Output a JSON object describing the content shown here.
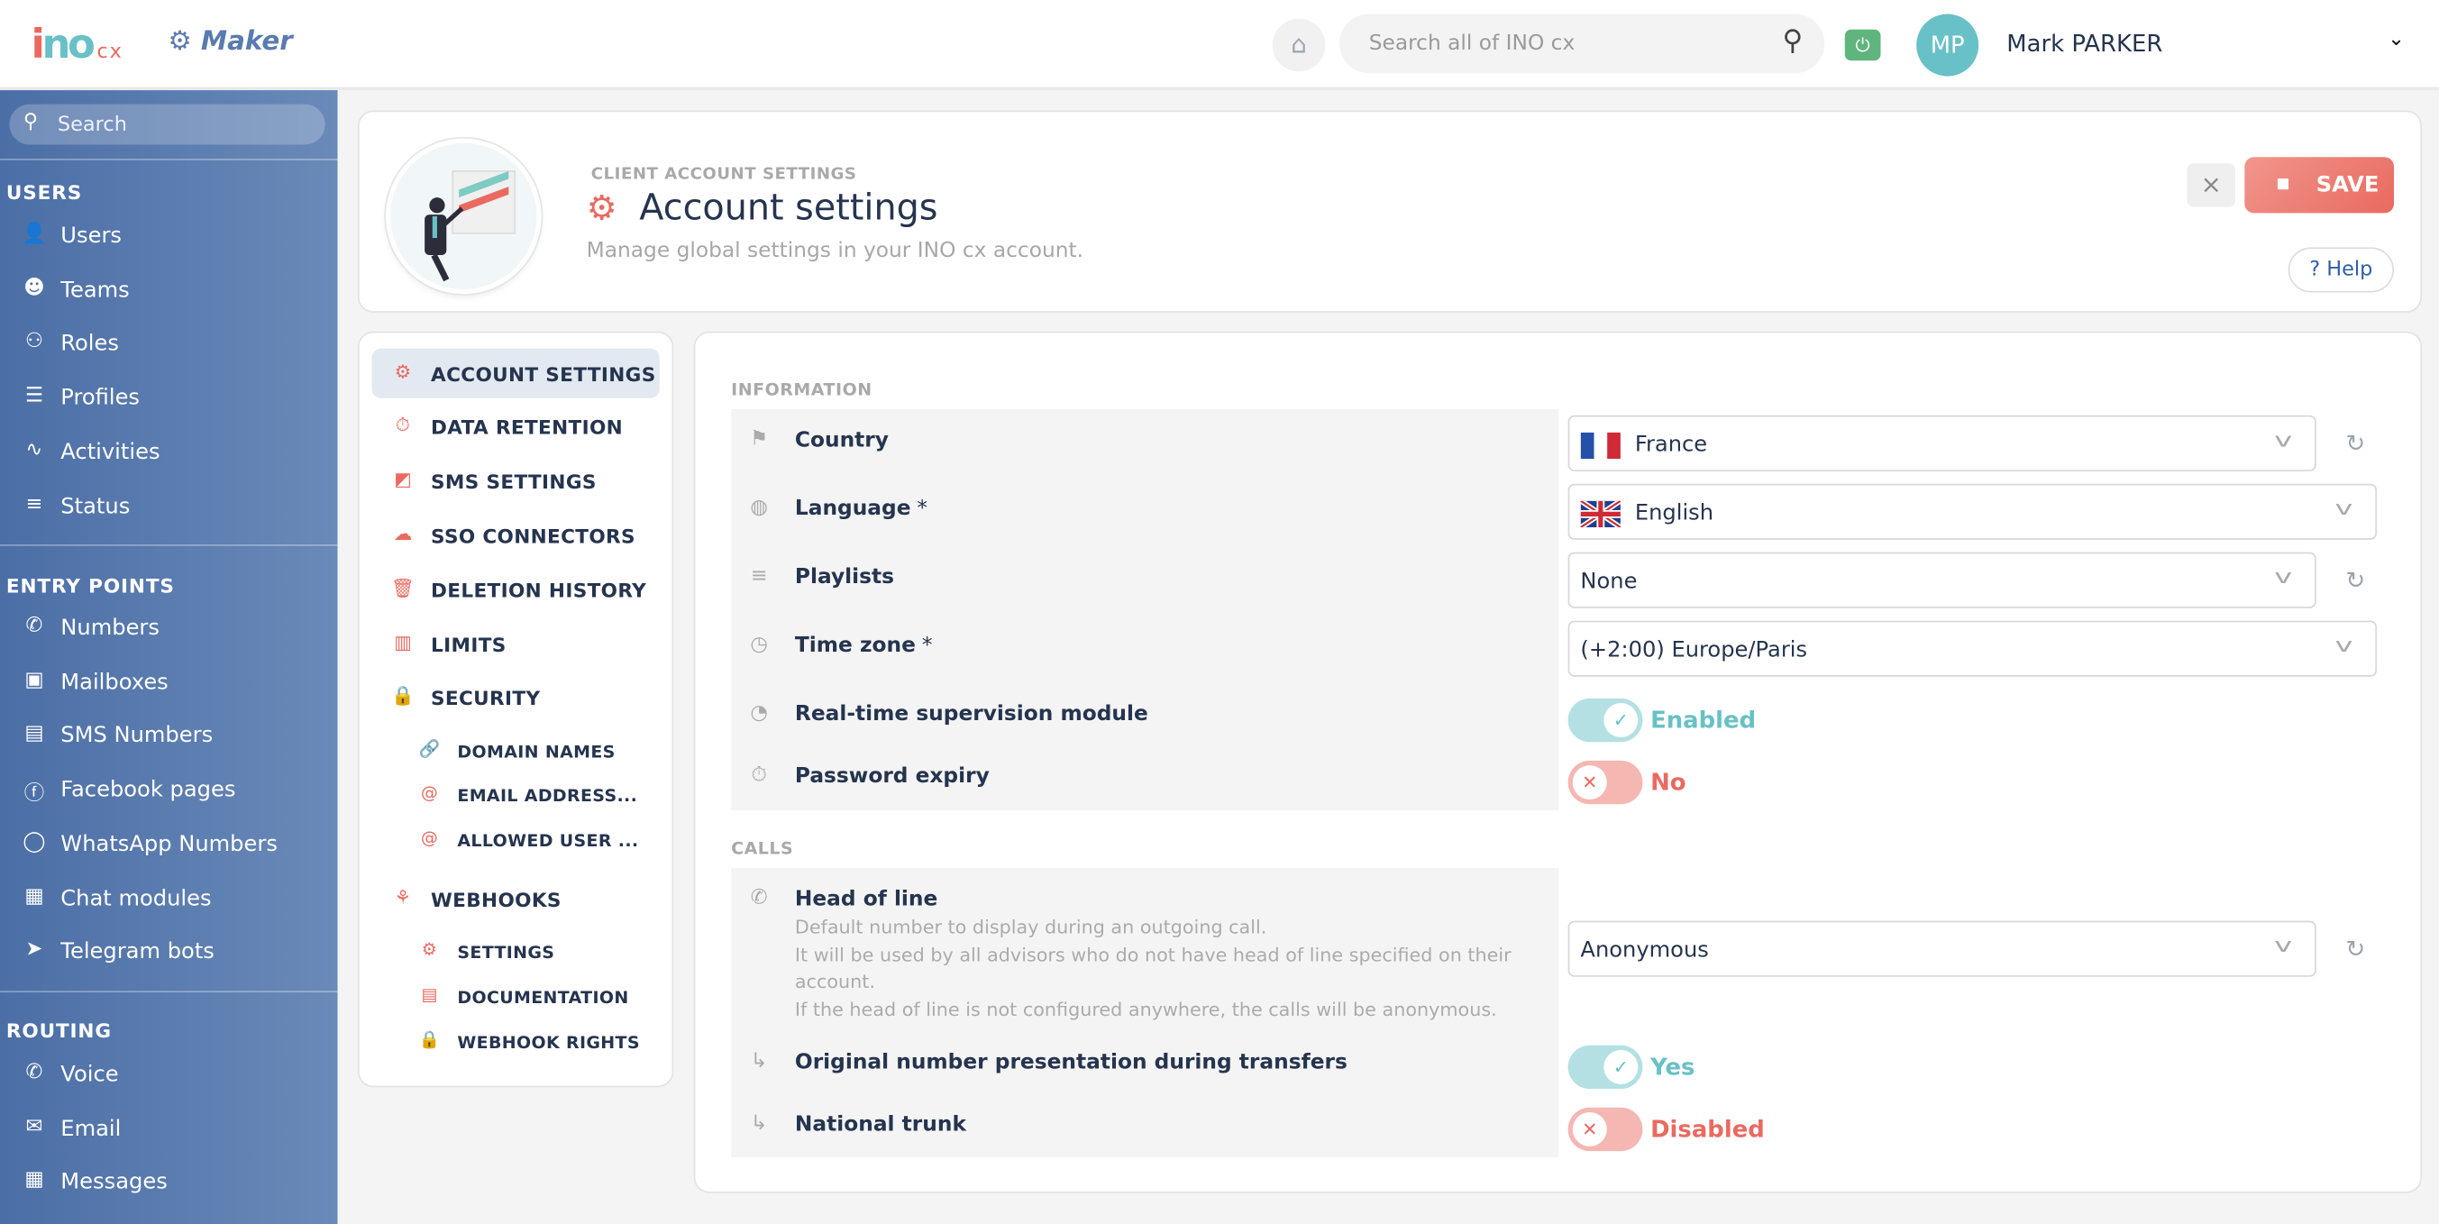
{
  "header": {
    "logo_text": "ino",
    "logo_suffix": "cx",
    "app_mode": "Maker",
    "search_placeholder": "Search all of INO cx",
    "user_initials": "MP",
    "user_name": "Mark PARKER"
  },
  "sidebar": {
    "search_placeholder": "Search",
    "sections": [
      {
        "title": "USERS",
        "items": [
          {
            "label": "Users",
            "icon": "👤"
          },
          {
            "label": "Teams",
            "icon": "☻"
          },
          {
            "label": "Roles",
            "icon": "⚇"
          },
          {
            "label": "Profiles",
            "icon": "☰"
          },
          {
            "label": "Activities",
            "icon": "∿"
          },
          {
            "label": "Status",
            "icon": "≡"
          }
        ]
      },
      {
        "title": "ENTRY POINTS",
        "items": [
          {
            "label": "Numbers",
            "icon": "✆"
          },
          {
            "label": "Mailboxes",
            "icon": "▣"
          },
          {
            "label": "SMS Numbers",
            "icon": "▤"
          },
          {
            "label": "Facebook pages",
            "icon": "ⓕ"
          },
          {
            "label": "WhatsApp Numbers",
            "icon": "◯"
          },
          {
            "label": "Chat modules",
            "icon": "▦"
          },
          {
            "label": "Telegram bots",
            "icon": "➤"
          }
        ]
      },
      {
        "title": "ROUTING",
        "items": [
          {
            "label": "Voice",
            "icon": "✆"
          },
          {
            "label": "Email",
            "icon": "✉"
          },
          {
            "label": "Messages",
            "icon": "▦"
          }
        ]
      }
    ]
  },
  "page": {
    "kicker": "CLIENT ACCOUNT SETTINGS",
    "title": "Account settings",
    "subtitle": "Manage global settings in your INO cx account.",
    "close_label": "×",
    "save_label": "SAVE",
    "help_label": "? Help"
  },
  "nav": [
    {
      "label": "ACCOUNT SETTINGS",
      "icon": "⚙",
      "active": true
    },
    {
      "label": "DATA RETENTION",
      "icon": "⏱"
    },
    {
      "label": "SMS SETTINGS",
      "icon": "◩"
    },
    {
      "label": "SSO CONNECTORS",
      "icon": "☁"
    },
    {
      "label": "DELETION HISTORY",
      "icon": "🗑"
    },
    {
      "label": "LIMITS",
      "icon": "▥"
    },
    {
      "label": "SECURITY",
      "icon": "🔒"
    },
    {
      "label": "DOMAIN NAMES",
      "icon": "🔗",
      "sub": true
    },
    {
      "label": "EMAIL ADDRESS...",
      "icon": "@",
      "sub": true
    },
    {
      "label": "ALLOWED USER ...",
      "icon": "@",
      "sub": true
    },
    {
      "label": "WEBHOOKS",
      "icon": "⚘"
    },
    {
      "label": "SETTINGS",
      "icon": "⚙",
      "sub": true
    },
    {
      "label": "DOCUMENTATION",
      "icon": "▤",
      "sub": true
    },
    {
      "label": "WEBHOOK RIGHTS",
      "icon": "🔒",
      "sub": true
    }
  ],
  "information": {
    "title": "INFORMATION",
    "country": {
      "label": "Country",
      "value": "France"
    },
    "language": {
      "label": "Language",
      "required": "*",
      "value": "English"
    },
    "playlists": {
      "label": "Playlists",
      "value": "None"
    },
    "timezone": {
      "label": "Time zone",
      "required": "*",
      "value": "(+2:00) Europe/Paris"
    },
    "supervision": {
      "label": "Real-time supervision module",
      "value": "Enabled",
      "on": true
    },
    "password_expiry": {
      "label": "Password expiry",
      "value": "No",
      "on": false
    }
  },
  "calls": {
    "title": "CALLS",
    "head_of_line": {
      "label": "Head of line",
      "description": [
        "Default number to display during an outgoing call.",
        "It will be used by all advisors who do not have head of line specified on their account.",
        "If the head of line is not configured anywhere, the calls will be anonymous."
      ],
      "value": "Anonymous"
    },
    "original_number": {
      "label": "Original number presentation during transfers",
      "value": "Yes",
      "on": true
    },
    "national_trunk": {
      "label": "National trunk",
      "value": "Disabled",
      "on": false
    }
  },
  "colors": {
    "accent": "#e96a60",
    "teal": "#68c1c6",
    "navy": "#25344f",
    "sidebar": "#4b6ea6"
  }
}
